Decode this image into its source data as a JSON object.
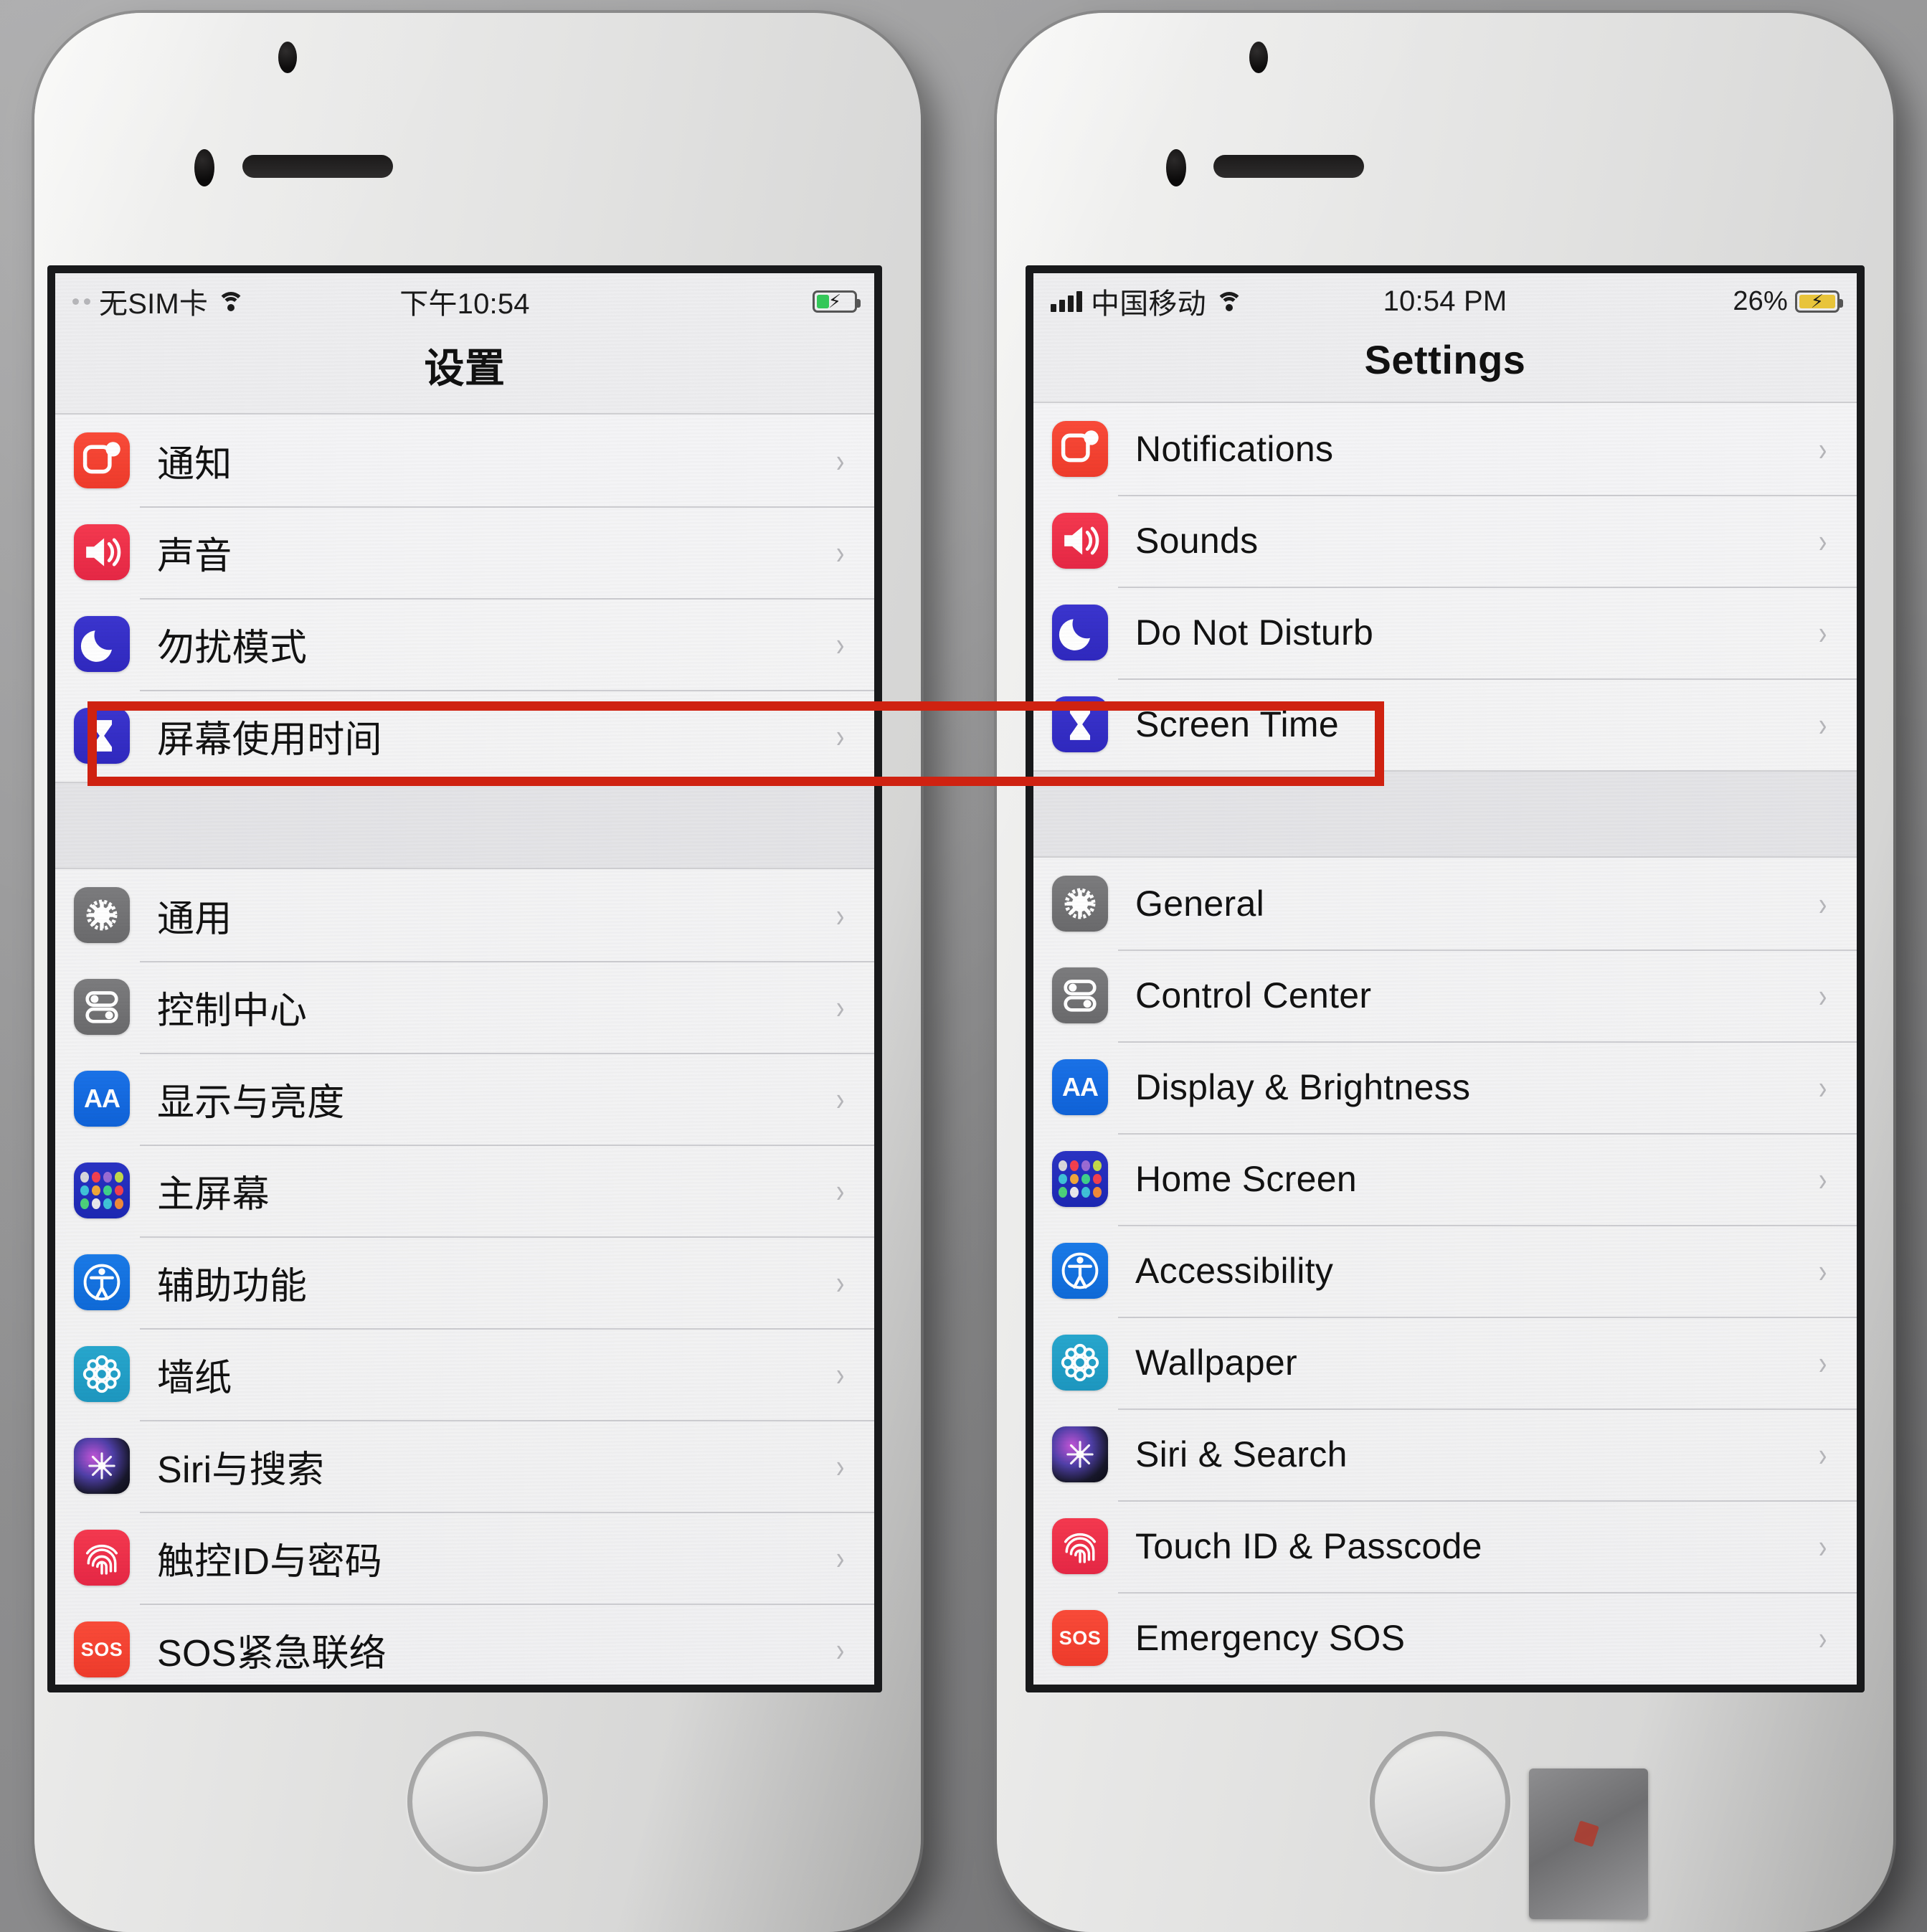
{
  "scene": {
    "description": "Two iPhones side by side showing the Settings app, left in Chinese and right in English, with a red rectangle highlighting the Screen Time row on both",
    "annotation_color": "#cf2211"
  },
  "left_phone": {
    "status_bar": {
      "carrier": "无SIM卡",
      "wifi_icon": "wifi-icon",
      "time": "下午10:54",
      "battery_percent": "",
      "battery_icon": "battery-charging-icon",
      "battery_color": "#34c759"
    },
    "nav_title": "设置",
    "groups": [
      {
        "rows": [
          {
            "icon": "notifications-icon",
            "label": "通知",
            "chevron": "›"
          },
          {
            "icon": "sounds-icon",
            "label": "声音",
            "chevron": "›"
          },
          {
            "icon": "do-not-disturb-icon",
            "label": "勿扰模式",
            "chevron": "›"
          },
          {
            "icon": "screen-time-icon",
            "label": "屏幕使用时间",
            "chevron": "›",
            "highlighted": true
          }
        ]
      },
      {
        "rows": [
          {
            "icon": "general-gear-icon",
            "label": "通用",
            "chevron": "›"
          },
          {
            "icon": "control-center-icon",
            "label": "控制中心",
            "chevron": "›"
          },
          {
            "icon": "display-brightness-icon",
            "label": "显示与亮度",
            "chevron": "›"
          },
          {
            "icon": "home-screen-icon",
            "label": "主屏幕",
            "chevron": "›"
          },
          {
            "icon": "accessibility-icon",
            "label": "辅助功能",
            "chevron": "›"
          },
          {
            "icon": "wallpaper-icon",
            "label": "墙纸",
            "chevron": "›"
          },
          {
            "icon": "siri-icon",
            "label": "Siri与搜索",
            "chevron": "›"
          },
          {
            "icon": "touch-id-icon",
            "label": "触控ID与密码",
            "chevron": "›"
          },
          {
            "icon": "emergency-sos-icon",
            "label": "SOS紧急联络",
            "chevron": "›"
          }
        ]
      }
    ]
  },
  "right_phone": {
    "status_bar": {
      "signal_icon": "cellular-signal-icon",
      "carrier": "中国移动",
      "wifi_icon": "wifi-icon",
      "time": "10:54 PM",
      "battery_percent": "26%",
      "battery_icon": "battery-charging-icon",
      "battery_color": "#e8c43a"
    },
    "nav_title": "Settings",
    "groups": [
      {
        "rows": [
          {
            "icon": "notifications-icon",
            "label": "Notifications",
            "chevron": "›"
          },
          {
            "icon": "sounds-icon",
            "label": "Sounds",
            "chevron": "›"
          },
          {
            "icon": "do-not-disturb-icon",
            "label": "Do Not Disturb",
            "chevron": "›"
          },
          {
            "icon": "screen-time-icon",
            "label": "Screen Time",
            "chevron": "›",
            "highlighted": true
          }
        ]
      },
      {
        "rows": [
          {
            "icon": "general-gear-icon",
            "label": "General",
            "chevron": "›"
          },
          {
            "icon": "control-center-icon",
            "label": "Control Center",
            "chevron": "›"
          },
          {
            "icon": "display-brightness-icon",
            "label": "Display & Brightness",
            "chevron": "›"
          },
          {
            "icon": "home-screen-icon",
            "label": "Home Screen",
            "chevron": "›"
          },
          {
            "icon": "accessibility-icon",
            "label": "Accessibility",
            "chevron": "›"
          },
          {
            "icon": "wallpaper-icon",
            "label": "Wallpaper",
            "chevron": "›"
          },
          {
            "icon": "siri-icon",
            "label": "Siri & Search",
            "chevron": "›"
          },
          {
            "icon": "touch-id-icon",
            "label": "Touch ID & Passcode",
            "chevron": "›"
          },
          {
            "icon": "emergency-sos-icon",
            "label": "Emergency SOS",
            "chevron": "›"
          }
        ]
      }
    ]
  },
  "icon_labels": {
    "display_brightness_glyph": "AA",
    "emergency_sos_glyph": "SOS"
  }
}
